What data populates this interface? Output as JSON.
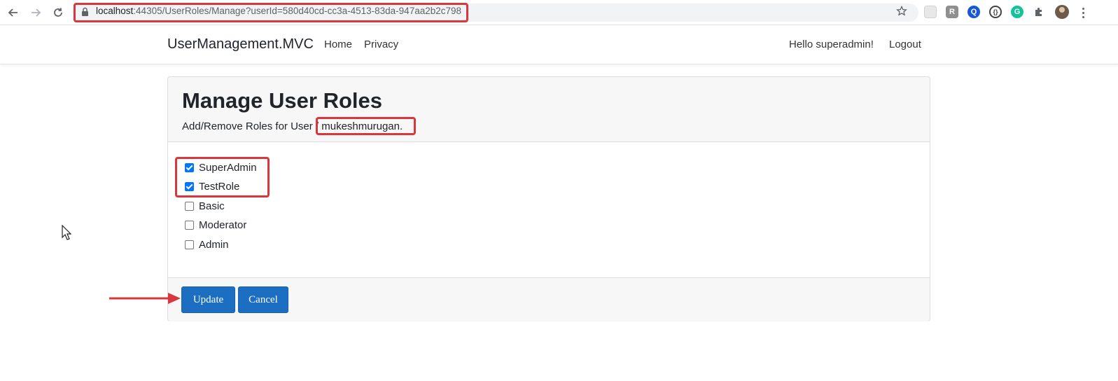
{
  "browser": {
    "url_host": "localhost",
    "url_rest": ":44305/UserRoles/Manage?userId=580d40cd-cc3a-4513-83da-947aa2b2c798",
    "extensions": [
      {
        "icon": "reader-ext-icon",
        "label": "",
        "color": "#dadce0"
      },
      {
        "icon": "r-ext-icon",
        "label": "R",
        "color": "#8f8f8f"
      },
      {
        "icon": "q-ext-icon",
        "label": "Q",
        "color": "#1a57d6"
      },
      {
        "icon": "code-ext-icon",
        "label": "{}",
        "color": "#ffffff"
      },
      {
        "icon": "grammarly-icon",
        "label": "G",
        "color": "#15c39a"
      },
      {
        "icon": "puzzle-icon",
        "label": "",
        "color": "#5f6368"
      }
    ]
  },
  "navbar": {
    "brand": "UserManagement.MVC",
    "links": [
      "Home",
      "Privacy"
    ],
    "greeting": "Hello superadmin!",
    "logout": "Logout"
  },
  "card": {
    "title": "Manage User Roles",
    "subtitle": "Add/Remove Roles for User / mukeshmurugan.",
    "roles": [
      {
        "name": "SuperAdmin",
        "checked": true
      },
      {
        "name": "TestRole",
        "checked": true
      },
      {
        "name": "Basic",
        "checked": false
      },
      {
        "name": "Moderator",
        "checked": false
      },
      {
        "name": "Admin",
        "checked": false
      }
    ],
    "update_label": "Update",
    "cancel_label": "Cancel"
  },
  "colors": {
    "annotation": "#d9363e",
    "primary_button": "#1b6ec2",
    "checkbox_checked": "#0075ff"
  }
}
